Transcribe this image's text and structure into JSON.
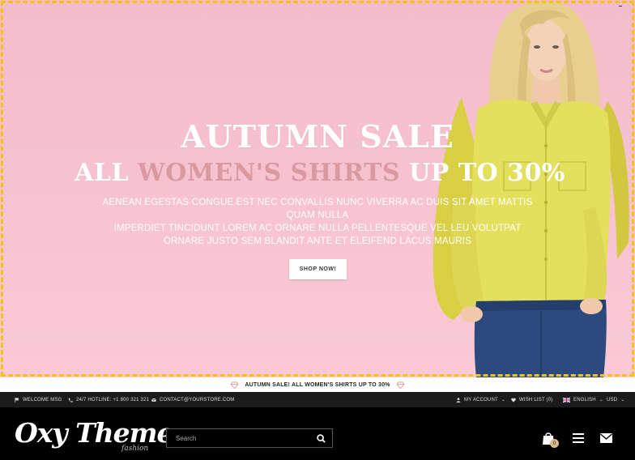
{
  "hero": {
    "title": "AUTUMN SALE",
    "subtitle_pre": "ALL ",
    "subtitle_highlight": "WOMEN'S SHIRTS",
    "subtitle_post": " UP TO 30%",
    "description_line1": "AENEAN EGESTAS CONGUE EST NEC CONVALLIS NUNC VIVERRA AC DUIS SIT AMET MATTIS QUAM NULLA",
    "description_line2": "IMPERDIET TINCIDUNT LOREM AC ORNARE NULLA PELLENTESQUE VEL LEU VOLUTPAT",
    "description_line3": "ORNARE JUSTO SEM BLANDIT ANTE ET ELEIFEND LACUS MAURIS",
    "button_label": "SHOP NOW!"
  },
  "promo": {
    "text": "AUTUMN SALE! ALL WOMEN'S SHIRTS UP TO 30%"
  },
  "topbar": {
    "welcome": "WELCOME MSG",
    "hotline": "24/7 HOTLINE: +1 800 321 321",
    "contact": "CONTACT@YOURSTORE.COM",
    "account": "MY ACCOUNT",
    "wishlist": "WISH LIST (0)",
    "language": "ENGLISH",
    "currency": "USD"
  },
  "header": {
    "logo_main": "Oxy Theme.",
    "logo_sub": "fashion",
    "search_placeholder": "Search",
    "cart_count": "0"
  },
  "colors": {
    "hero_bg": "#f6c0ce",
    "accent_border": "#f2c21a",
    "highlight_text": "#d89aa0",
    "topbar_bg": "#1b1b1b",
    "header_bg": "#000000",
    "cart_badge": "#d8b98b"
  },
  "icons": {
    "welcome": "flag-icon",
    "hotline": "phone-icon",
    "contact": "envelope-icon",
    "account": "user-icon",
    "wishlist": "heart-icon",
    "language": "uk-flag-icon",
    "search": "search-icon",
    "cart": "shopping-bag-icon",
    "menu": "hamburger-menu-icon",
    "mail": "mail-icon",
    "promo": "diamond-icon"
  }
}
